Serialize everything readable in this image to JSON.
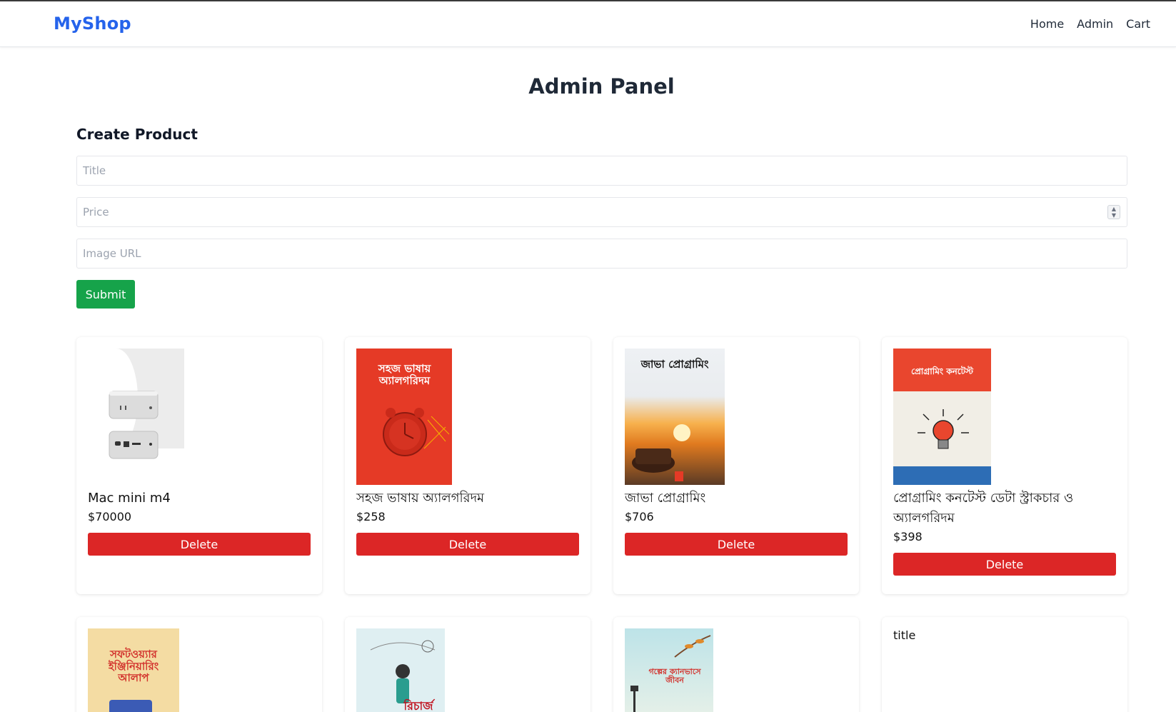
{
  "brand": "MyShop",
  "nav": {
    "home": "Home",
    "admin": "Admin",
    "cart": "Cart"
  },
  "page_title": "Admin Panel",
  "form": {
    "heading": "Create Product",
    "title_placeholder": "Title",
    "price_placeholder": "Price",
    "image_placeholder": "Image URL",
    "title_value": "",
    "price_value": "",
    "image_value": "",
    "submit_label": "Submit"
  },
  "products": [
    {
      "title": "Mac mini m4",
      "price": "$70000",
      "delete_label": "Delete"
    },
    {
      "title": "সহজ ভাষায় অ্যালগরিদম",
      "price": "$258",
      "delete_label": "Delete"
    },
    {
      "title": "জাভা প্রোগ্রামিং",
      "price": "$706",
      "delete_label": "Delete"
    },
    {
      "title": "প্রোগ্রামিং কনটেস্ট ডেটা স্ট্রাকচার ও অ্যালগরিদম",
      "price": "$398",
      "delete_label": "Delete"
    }
  ],
  "products_row2": [
    {
      "cover_text": "সফটওয়্যার ইঞ্জিনিয়ারিং আলাপ"
    },
    {
      "cover_text": "রিচার্জ"
    },
    {
      "cover_text": "গল্পের ক্যানভাসে জীবন"
    },
    {
      "title": "title"
    }
  ],
  "covers": {
    "algo_text": "সহজ ভাষায় অ্যালগরিদম",
    "java_text": "জাভা প্রোগ্রামিং",
    "contest_text": "প্রোগ্রামিং কনটেস্ট"
  },
  "colors": {
    "brand": "#2563eb",
    "submit": "#16a34a",
    "delete": "#dc2626"
  }
}
